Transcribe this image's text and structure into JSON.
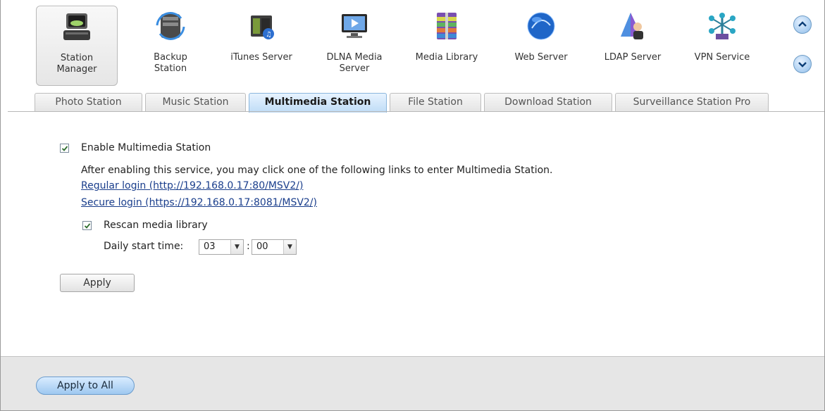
{
  "toolbar": {
    "items": [
      {
        "label": "Station\nManager",
        "icon": "station-manager-icon",
        "active": true
      },
      {
        "label": "Backup\nStation",
        "icon": "backup-station-icon"
      },
      {
        "label": "iTunes Server",
        "icon": "itunes-server-icon"
      },
      {
        "label": "DLNA Media\nServer",
        "icon": "dlna-media-server-icon"
      },
      {
        "label": "Media Library",
        "icon": "media-library-icon"
      },
      {
        "label": "Web Server",
        "icon": "web-server-icon"
      },
      {
        "label": "LDAP Server",
        "icon": "ldap-server-icon"
      },
      {
        "label": "VPN Service",
        "icon": "vpn-service-icon"
      }
    ],
    "scroll_up_icon": "chevron-up-icon",
    "scroll_down_icon": "chevron-down-icon"
  },
  "tabs": [
    {
      "label": "Photo Station"
    },
    {
      "label": "Music Station"
    },
    {
      "label": "Multimedia Station",
      "active": true
    },
    {
      "label": "File Station"
    },
    {
      "label": "Download Station"
    },
    {
      "label": "Surveillance Station Pro"
    }
  ],
  "main": {
    "enable_label": "Enable Multimedia Station",
    "enable_checked": true,
    "description": "After enabling this service, you may click one of the following links to enter Multimedia Station.",
    "regular_login": "Regular login (http://192.168.0.17:80/MSV2/)",
    "secure_login": "Secure login (https://192.168.0.17:8081/MSV2/)",
    "rescan_label": "Rescan media library",
    "rescan_checked": true,
    "daily_start_label": "Daily start time:",
    "hour_value": "03",
    "minute_value": "00",
    "time_separator": ":",
    "apply_label": "Apply"
  },
  "footer": {
    "apply_all_label": "Apply to All"
  },
  "colors": {
    "active_tab": "#bfdcf6",
    "link": "#1a3e8c",
    "footer_bg": "#e6e6e6"
  }
}
